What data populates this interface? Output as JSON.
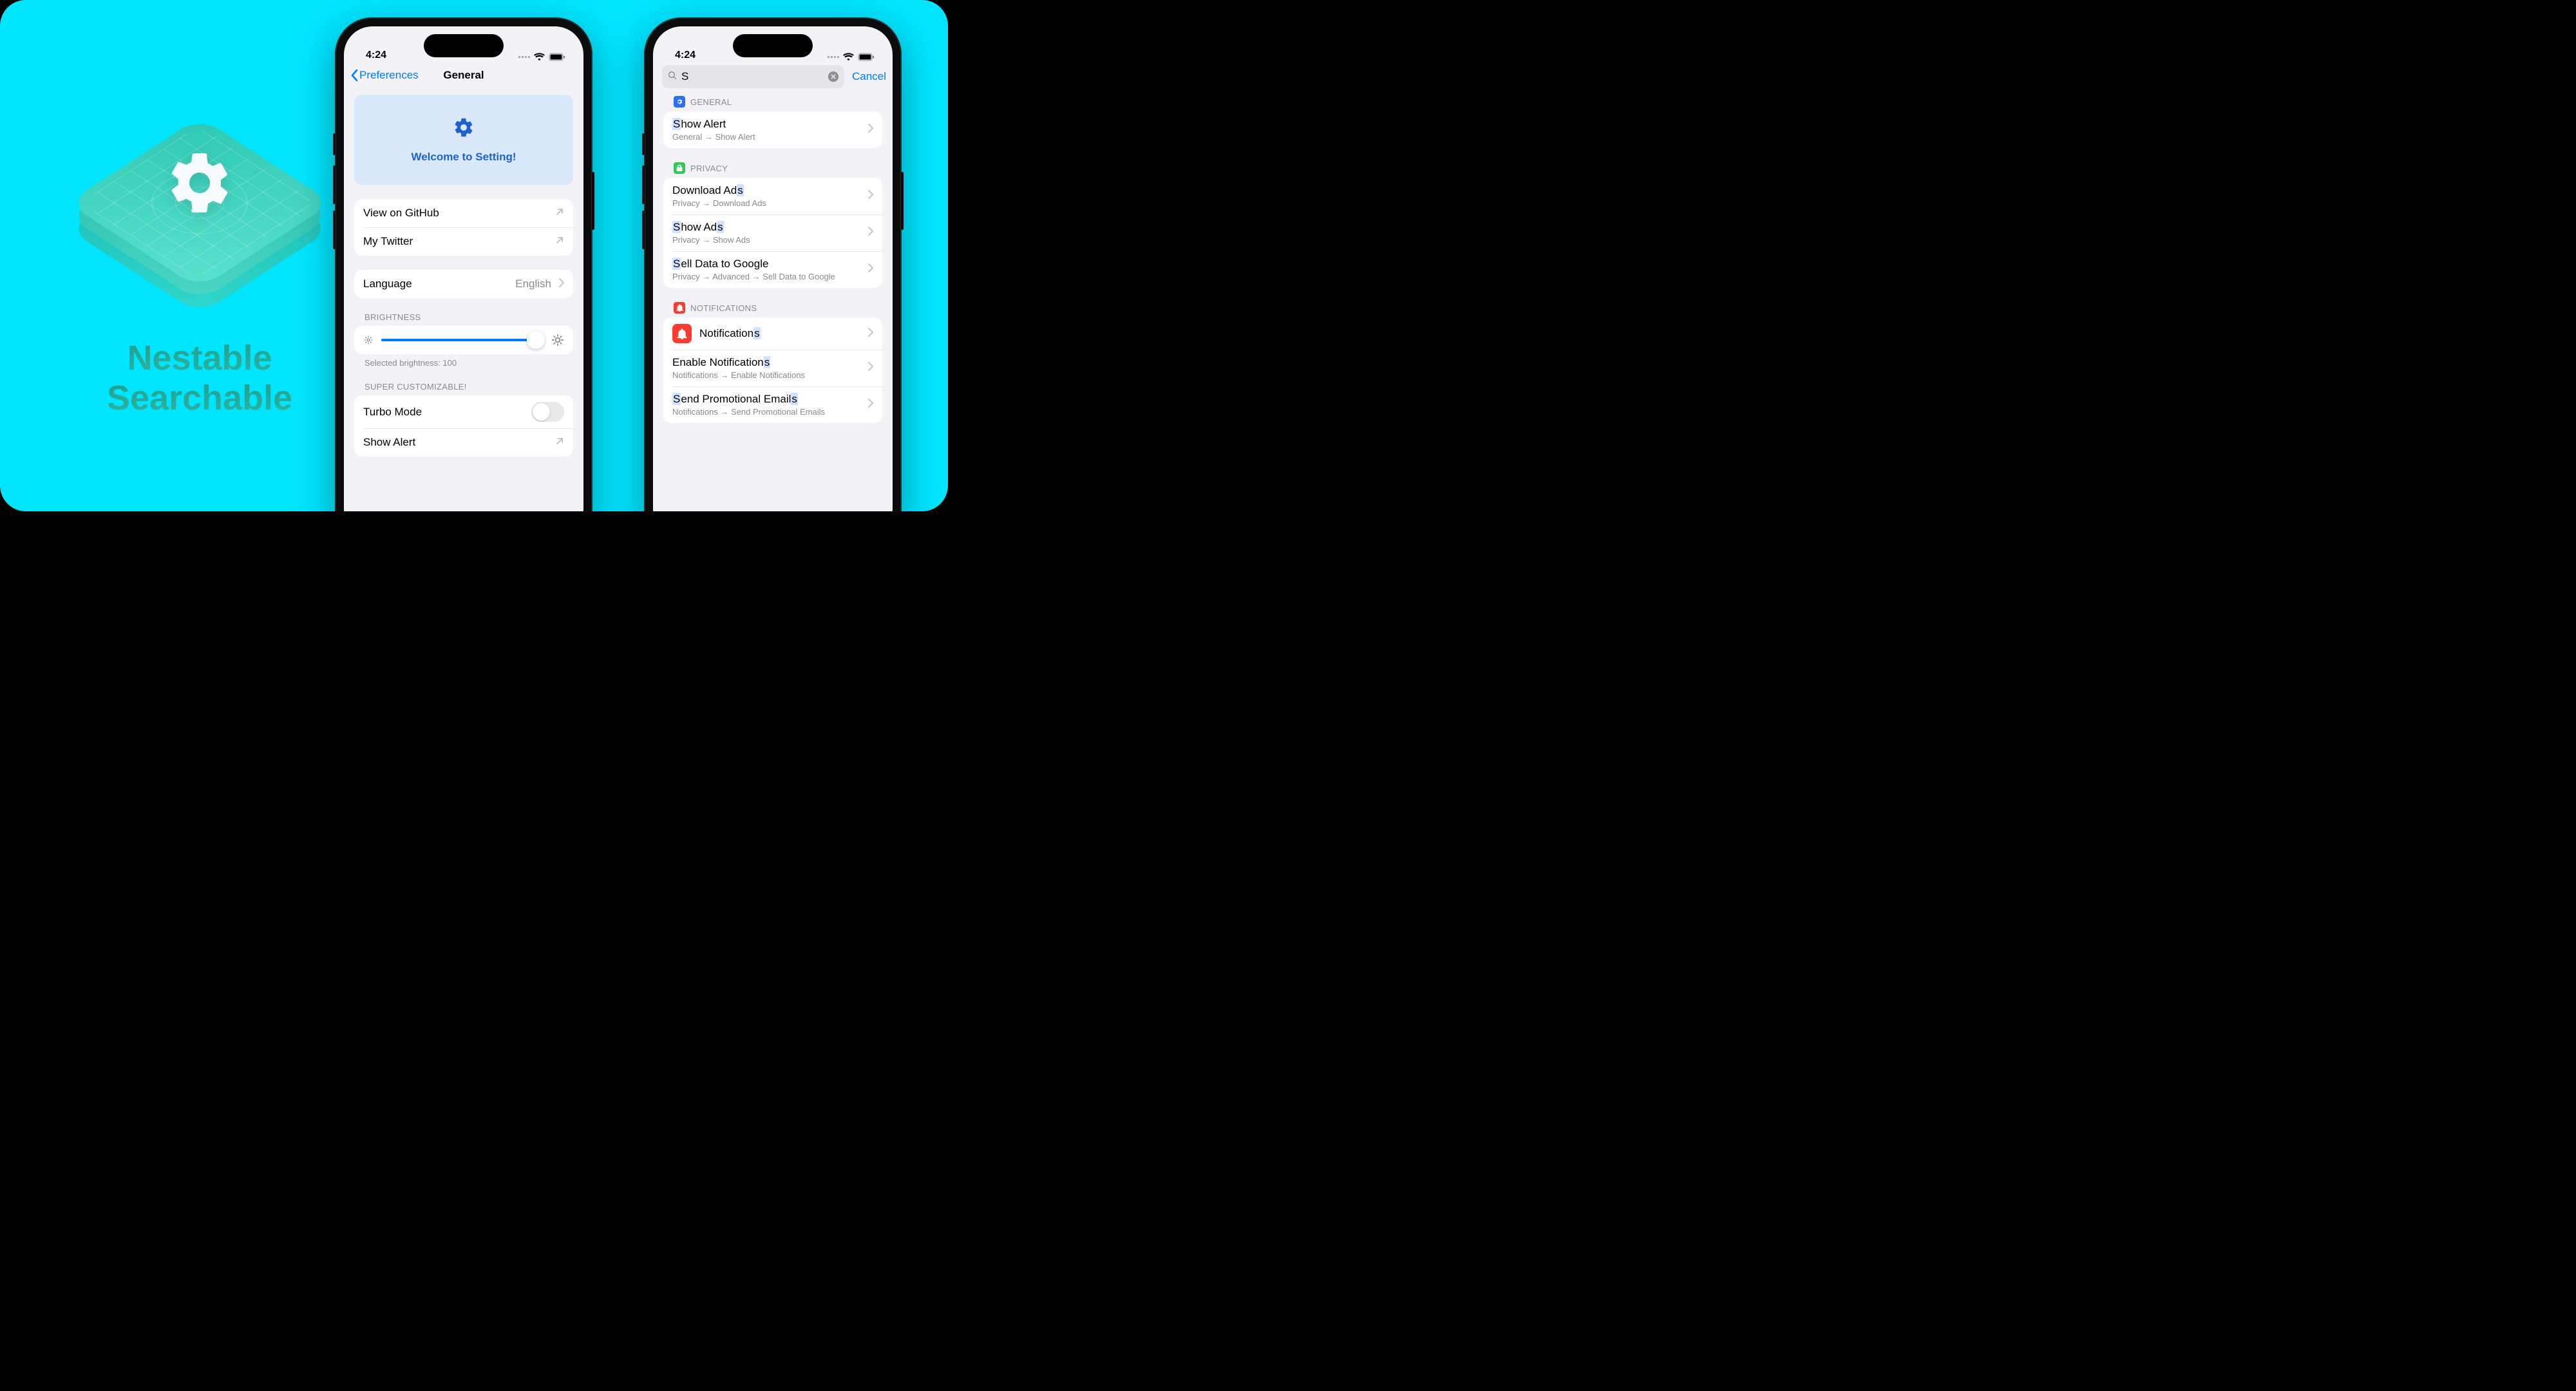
{
  "taglines": {
    "line1": "Nestable",
    "line2": "Searchable"
  },
  "status": {
    "time": "4:24"
  },
  "phone1": {
    "back_label": "Preferences",
    "title": "General",
    "hero": "Welcome to Setting!",
    "links": {
      "github": "View on GitHub",
      "twitter": "My Twitter"
    },
    "language": {
      "label": "Language",
      "value": "English"
    },
    "brightness": {
      "header": "BRIGHTNESS",
      "value": 100,
      "footer": "Selected brightness: 100"
    },
    "custom": {
      "header": "SUPER CUSTOMIZABLE!",
      "turbo": "Turbo Mode",
      "show_alert": "Show Alert"
    }
  },
  "phone2": {
    "query": "S",
    "cancel": "Cancel",
    "sections": {
      "general": {
        "header": "GENERAL",
        "items": [
          {
            "title": "Show Alert",
            "path": "General → Show Alert"
          }
        ]
      },
      "privacy": {
        "header": "PRIVACY",
        "items": [
          {
            "title": "Download Ads",
            "path": "Privacy → Download Ads"
          },
          {
            "title": "Show Ads",
            "path": "Privacy → Show Ads"
          },
          {
            "title": "Sell Data to Google",
            "path": "Privacy → Advanced → Sell Data to Google"
          }
        ]
      },
      "notifications": {
        "header": "NOTIFICATIONS",
        "items": [
          {
            "title": "Notifications",
            "badge": true
          },
          {
            "title": "Enable Notifications",
            "path": "Notifications → Enable Notifications"
          },
          {
            "title": "Send Promotional Emails",
            "path": "Notifications → Send Promotional Emails"
          }
        ]
      }
    }
  }
}
